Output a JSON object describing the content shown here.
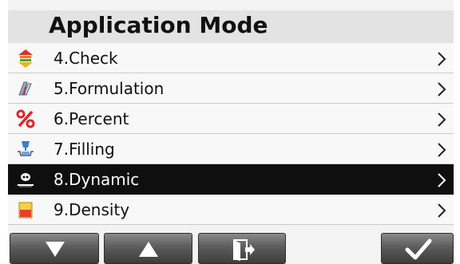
{
  "header": {
    "title": "Application Mode"
  },
  "modes": [
    {
      "label": "4.Check",
      "icon": "check-mode-icon"
    },
    {
      "label": "5.Formulation",
      "icon": "formulation-mode-icon"
    },
    {
      "label": "6.Percent",
      "icon": "percent-mode-icon"
    },
    {
      "label": "7.Filling",
      "icon": "filling-mode-icon"
    },
    {
      "label": "8.Dynamic",
      "icon": "dynamic-mode-icon",
      "selected": true
    },
    {
      "label": "9.Density",
      "icon": "density-mode-icon"
    }
  ],
  "toolbar": {
    "buttons": [
      "scroll-down",
      "scroll-up",
      "exit",
      "confirm"
    ]
  },
  "colors": {
    "selected_row_bg": "#0f0f0f",
    "title_bar_bg": "#e3e3e3",
    "toolbar_button": "#5c5c5c"
  }
}
